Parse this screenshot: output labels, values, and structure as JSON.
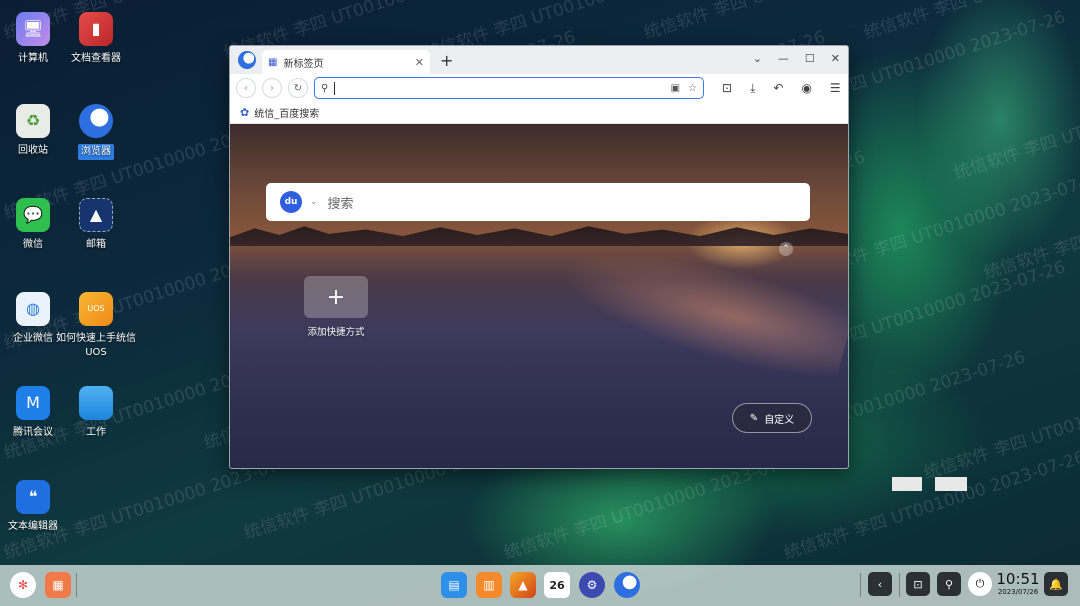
{
  "watermark": "统信软件 李四 UT0010000 2023-07-26",
  "desktop": {
    "icons": [
      {
        "label": "计算机",
        "icon": "computer-icon"
      },
      {
        "label": "文档查看器",
        "icon": "document-viewer-icon"
      },
      {
        "label": "回收站",
        "icon": "trash-icon"
      },
      {
        "label": "浏览器",
        "icon": "browser-icon"
      },
      {
        "label": "微信",
        "icon": "wechat-icon"
      },
      {
        "label": "邮箱",
        "icon": "mail-icon"
      },
      {
        "label": "企业微信",
        "icon": "wecom-icon"
      },
      {
        "label": "如何快速上手统信UOS",
        "icon": "help-icon"
      },
      {
        "label": "腾讯会议",
        "icon": "tencent-meeting-icon"
      },
      {
        "label": "工作",
        "icon": "folder-icon"
      },
      {
        "label": "文本编辑器",
        "icon": "text-editor-icon"
      }
    ]
  },
  "browser": {
    "tab_title": "新标签页",
    "tab_close": "✕",
    "new_tab": "+",
    "window_controls": {
      "menu": "⌄",
      "minimize": "—",
      "maximize": "☐",
      "close": "✕"
    },
    "url_value": "",
    "bookmark": "统信_百度搜索",
    "search_placeholder": "搜索",
    "baidu_logo": "du",
    "add_shortcut_label": "添加快捷方式",
    "add_shortcut_plus": "+",
    "customize_label": "自定义"
  },
  "taskbar": {
    "time": "10:51",
    "date": "2023/07/26",
    "calendar_day": "26"
  },
  "colors": {
    "accent": "#2f7de1",
    "url_border": "#3b7be6"
  }
}
